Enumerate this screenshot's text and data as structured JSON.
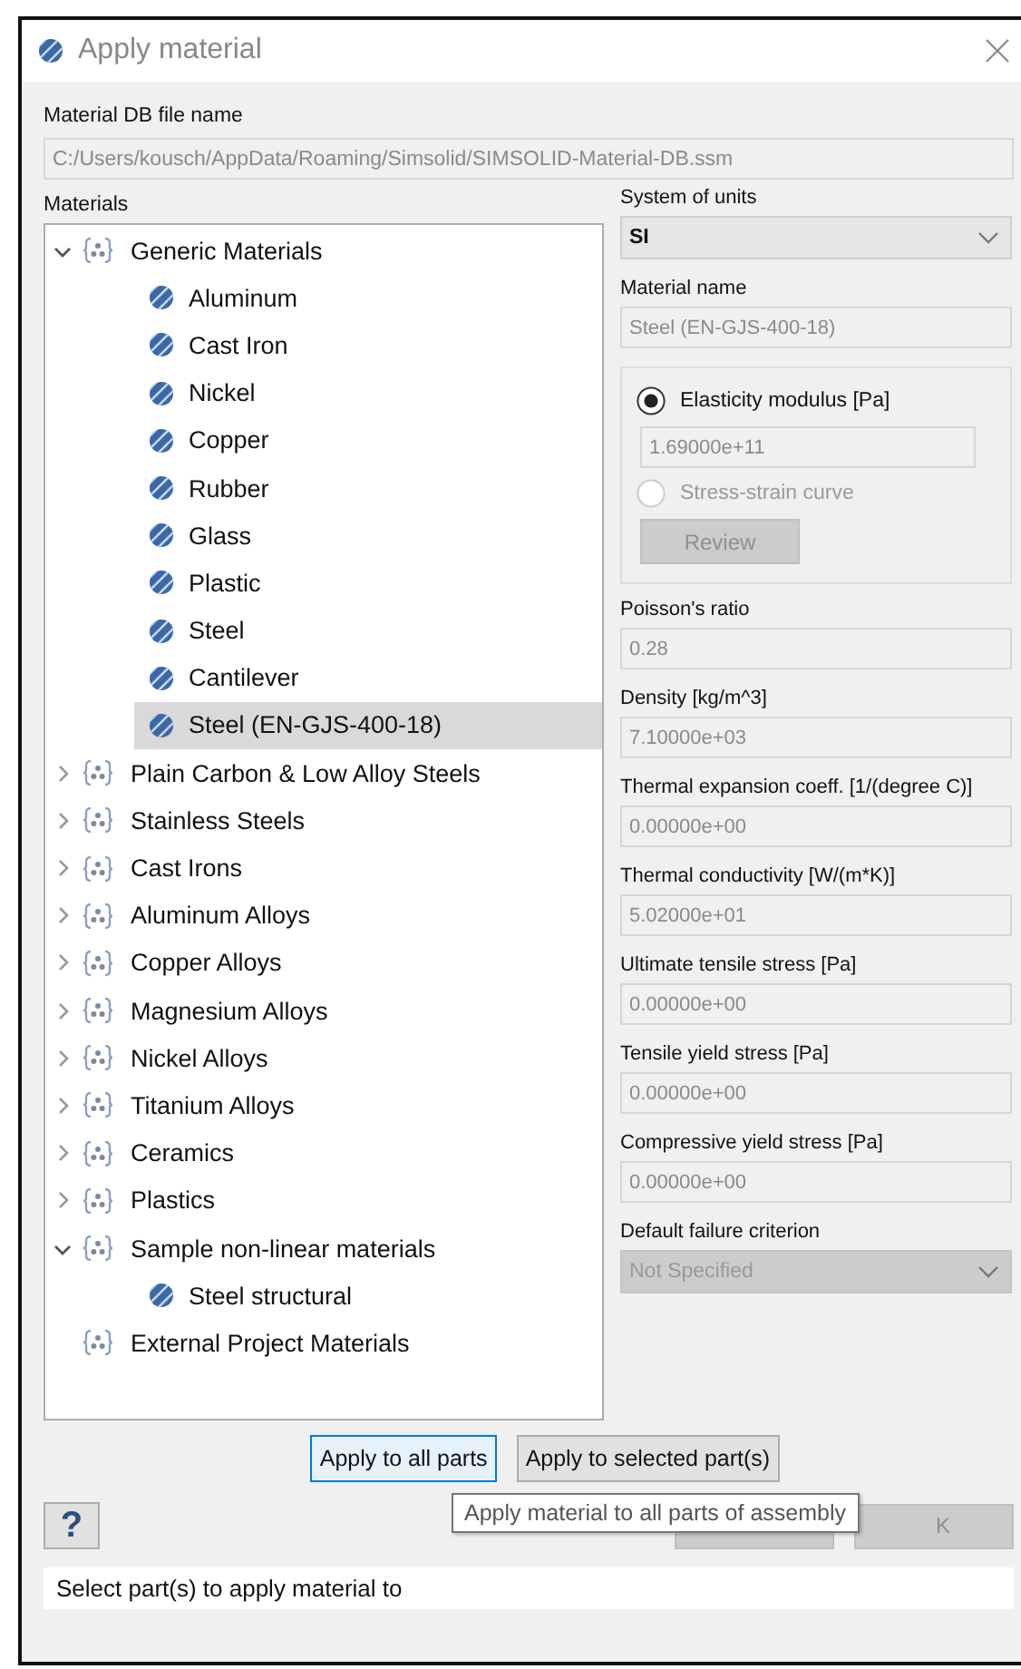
{
  "window": {
    "title": "Apply material"
  },
  "db_file": {
    "label": "Material DB file name",
    "value": "C:/Users/kousch/AppData/Roaming/Simsolid/SIMSOLID-Material-DB.ssm",
    "disabled": true
  },
  "materials": {
    "label": "Materials",
    "tree": [
      {
        "label": "Generic Materials",
        "kind": "group",
        "expanded": true,
        "selected": false,
        "children": [
          {
            "label": "Aluminum",
            "kind": "material",
            "selected": false
          },
          {
            "label": "Cast Iron",
            "kind": "material",
            "selected": false
          },
          {
            "label": "Nickel",
            "kind": "material",
            "selected": false
          },
          {
            "label": "Copper",
            "kind": "material",
            "selected": false
          },
          {
            "label": "Rubber",
            "kind": "material",
            "selected": false
          },
          {
            "label": "Glass",
            "kind": "material",
            "selected": false
          },
          {
            "label": "Plastic",
            "kind": "material",
            "selected": false
          },
          {
            "label": "Steel",
            "kind": "material",
            "selected": false
          },
          {
            "label": "Cantilever",
            "kind": "material",
            "selected": false
          },
          {
            "label": "Steel (EN-GJS-400-18)",
            "kind": "material",
            "selected": true
          }
        ]
      },
      {
        "label": "Plain Carbon & Low Alloy Steels",
        "kind": "group",
        "expanded": false,
        "selected": false
      },
      {
        "label": "Stainless Steels",
        "kind": "group",
        "expanded": false,
        "selected": false
      },
      {
        "label": "Cast Irons",
        "kind": "group",
        "expanded": false,
        "selected": false
      },
      {
        "label": "Aluminum Alloys",
        "kind": "group",
        "expanded": false,
        "selected": false
      },
      {
        "label": "Copper Alloys",
        "kind": "group",
        "expanded": false,
        "selected": false
      },
      {
        "label": "Magnesium Alloys",
        "kind": "group",
        "expanded": false,
        "selected": false
      },
      {
        "label": "Nickel Alloys",
        "kind": "group",
        "expanded": false,
        "selected": false
      },
      {
        "label": "Titanium Alloys",
        "kind": "group",
        "expanded": false,
        "selected": false
      },
      {
        "label": "Ceramics",
        "kind": "group",
        "expanded": false,
        "selected": false
      },
      {
        "label": "Plastics",
        "kind": "group",
        "expanded": false,
        "selected": false
      },
      {
        "label": "Sample non-linear materials",
        "kind": "group",
        "expanded": true,
        "selected": false,
        "children": [
          {
            "label": "Steel structural",
            "kind": "material",
            "selected": false
          }
        ]
      },
      {
        "label": "External Project Materials",
        "kind": "group",
        "selected": false
      }
    ]
  },
  "properties": {
    "units": {
      "label": "System of units",
      "value": "SI",
      "kind": "dropdown",
      "disabled": false
    },
    "material_name": {
      "label": "Material name",
      "value": "Steel (EN-GJS-400-18)",
      "kind": "text",
      "disabled": true
    },
    "modulus": {
      "options": [
        {
          "label": "Elasticity modulus [Pa]",
          "selected": true,
          "disabled": false
        },
        {
          "label": "Stress-strain curve",
          "selected": false,
          "disabled": true
        }
      ],
      "value": "1.69000e+11",
      "value_disabled": true,
      "review_button": {
        "label": "Review",
        "disabled": true
      }
    },
    "fields": [
      {
        "label": "Poisson's ratio",
        "value": "0.28",
        "kind": "text",
        "disabled": true
      },
      {
        "label": "Density [kg/m^3]",
        "value": "7.10000e+03",
        "kind": "text",
        "disabled": true
      },
      {
        "label": "Thermal expansion coeff. [1/(degree C)]",
        "value": "0.00000e+00",
        "kind": "text",
        "disabled": true
      },
      {
        "label": "Thermal conductivity [W/(m*K)]",
        "value": "5.02000e+01",
        "kind": "text",
        "disabled": true
      },
      {
        "label": "Ultimate tensile stress [Pa]",
        "value": "0.00000e+00",
        "kind": "text",
        "disabled": true
      },
      {
        "label": "Tensile yield stress [Pa]",
        "value": "0.00000e+00",
        "kind": "text",
        "disabled": true
      },
      {
        "label": "Compressive yield stress [Pa]",
        "value": "0.00000e+00",
        "kind": "text",
        "disabled": true
      },
      {
        "label": "Default failure criterion",
        "value": "Not Specified",
        "kind": "dropdown",
        "disabled": true
      }
    ]
  },
  "apply_buttons": [
    {
      "label": "Apply to all parts",
      "focused": true
    },
    {
      "label": "Apply to selected part(s)",
      "focused": false
    }
  ],
  "help_button": {
    "label": "?"
  },
  "dialog_buttons": [
    {
      "kind": "covered"
    },
    {
      "kind": "text",
      "label": "K"
    }
  ],
  "tooltip": {
    "text": "Apply material to all parts of assembly"
  },
  "status_bar": {
    "text": "Select part(s) to apply material to"
  }
}
